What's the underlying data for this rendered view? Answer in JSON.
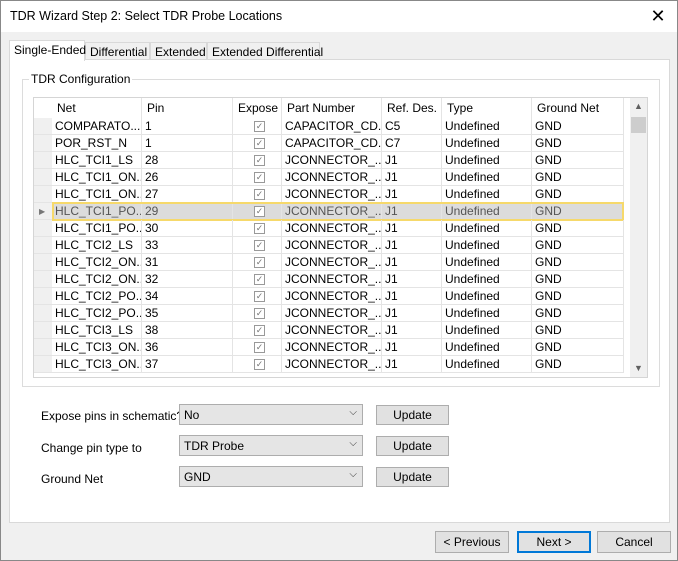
{
  "window": {
    "title": "TDR Wizard Step 2: Select TDR Probe Locations",
    "close_icon": "close-icon"
  },
  "tabs": [
    {
      "label": "Single-Ended",
      "active": true
    },
    {
      "label": "Differential"
    },
    {
      "label": "Extended"
    },
    {
      "label": "Extended Differential"
    }
  ],
  "group": {
    "label": "TDR Configuration"
  },
  "table": {
    "columns": [
      "Net",
      "Pin",
      "Expose",
      "Part Number",
      "Ref. Des.",
      "Type",
      "Ground Net"
    ],
    "rows": [
      [
        "COMPARATO...",
        "1",
        true,
        "CAPACITOR_CD...",
        "C5",
        "Undefined",
        "GND"
      ],
      [
        "POR_RST_N",
        "1",
        true,
        "CAPACITOR_CD...",
        "C7",
        "Undefined",
        "GND"
      ],
      [
        "HLC_TCI1_LS",
        "28",
        true,
        "JCONNECTOR_...",
        "J1",
        "Undefined",
        "GND"
      ],
      [
        "HLC_TCI1_ON...",
        "26",
        true,
        "JCONNECTOR_...",
        "J1",
        "Undefined",
        "GND"
      ],
      [
        "HLC_TCI1_ON...",
        "27",
        true,
        "JCONNECTOR_...",
        "J1",
        "Undefined",
        "GND"
      ],
      [
        "HLC_TCI1_PO...",
        "29",
        true,
        "JCONNECTOR_...",
        "J1",
        "Undefined",
        "GND"
      ],
      [
        "HLC_TCI1_PO...",
        "30",
        true,
        "JCONNECTOR_...",
        "J1",
        "Undefined",
        "GND"
      ],
      [
        "HLC_TCI2_LS",
        "33",
        true,
        "JCONNECTOR_...",
        "J1",
        "Undefined",
        "GND"
      ],
      [
        "HLC_TCI2_ON...",
        "31",
        true,
        "JCONNECTOR_...",
        "J1",
        "Undefined",
        "GND"
      ],
      [
        "HLC_TCI2_ON...",
        "32",
        true,
        "JCONNECTOR_...",
        "J1",
        "Undefined",
        "GND"
      ],
      [
        "HLC_TCI2_PO...",
        "34",
        true,
        "JCONNECTOR_...",
        "J1",
        "Undefined",
        "GND"
      ],
      [
        "HLC_TCI2_PO...",
        "35",
        true,
        "JCONNECTOR_...",
        "J1",
        "Undefined",
        "GND"
      ],
      [
        "HLC_TCI3_LS",
        "38",
        true,
        "JCONNECTOR_...",
        "J1",
        "Undefined",
        "GND"
      ],
      [
        "HLC_TCI3_ON...",
        "36",
        true,
        "JCONNECTOR_...",
        "J1",
        "Undefined",
        "GND"
      ],
      [
        "HLC_TCI3_ON...",
        "37",
        true,
        "JCONNECTOR_...",
        "J1",
        "Undefined",
        "GND"
      ]
    ],
    "selected_row": 5
  },
  "form": [
    {
      "label": "Expose pins in schematic?",
      "value": "No",
      "button": "Update"
    },
    {
      "label": "Change pin type to",
      "value": "TDR Probe",
      "button": "Update"
    },
    {
      "label": "Ground Net",
      "value": "GND",
      "button": "Update"
    }
  ],
  "footer": {
    "previous": "< Previous",
    "next": "Next >",
    "cancel": "Cancel"
  },
  "colors": {
    "selection_border": "#f6d96b",
    "default_button": "#0078d7"
  }
}
